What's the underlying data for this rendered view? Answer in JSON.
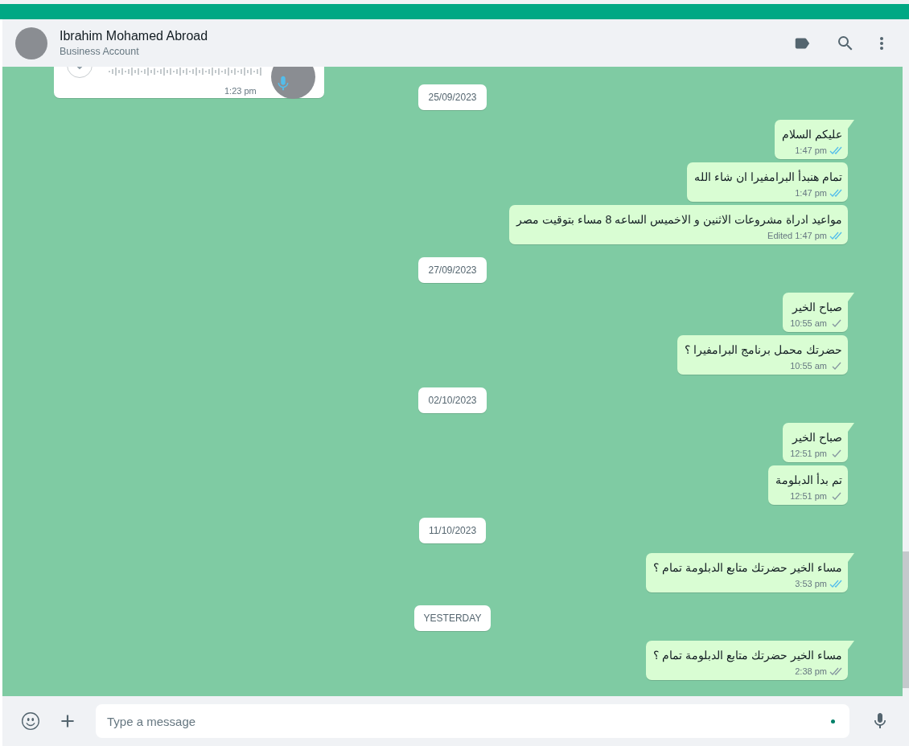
{
  "header": {
    "name": "Ibrahim Mohamed Abroad",
    "subtitle": "Business Account"
  },
  "voice_note": {
    "time": "1:23 pm"
  },
  "items": [
    {
      "kind": "date",
      "text": "25/09/2023"
    },
    {
      "kind": "message",
      "text": "عليكم السلام",
      "time": "1:47 pm",
      "delivered": true,
      "read": true,
      "tail": true
    },
    {
      "kind": "message",
      "text": "تمام هنبدأ البرامفيرا ان شاء الله",
      "time": "1:47 pm",
      "delivered": true,
      "read": true,
      "tail": false
    },
    {
      "kind": "message",
      "text": "مواعيد ادراة مشروعات الاثنين و الاخميس الساعه 8 مساء بتوقيت مصر",
      "time": "1:47 pm",
      "delivered": true,
      "read": true,
      "tail": false,
      "edited": "Edited"
    },
    {
      "kind": "date",
      "text": "27/09/2023"
    },
    {
      "kind": "message",
      "text": "صباح الخير",
      "time": "10:55 am",
      "delivered": false,
      "read": false,
      "tail": true
    },
    {
      "kind": "message",
      "text": "حضرتك محمل برنامج البرامفيرا ؟",
      "time": "10:55 am",
      "delivered": false,
      "read": false,
      "tail": false
    },
    {
      "kind": "date",
      "text": "02/10/2023"
    },
    {
      "kind": "message",
      "text": "صباح الخير",
      "time": "12:51 pm",
      "delivered": false,
      "read": false,
      "tail": true
    },
    {
      "kind": "message",
      "text": "تم بدأ الدبلومة",
      "time": "12:51 pm",
      "delivered": false,
      "read": false,
      "tail": false
    },
    {
      "kind": "date",
      "text": "11/10/2023"
    },
    {
      "kind": "message",
      "text": "مساء الخير حضرتك متابع الدبلومة تمام ؟",
      "time": "3:53 pm",
      "delivered": true,
      "read": true,
      "tail": true
    },
    {
      "kind": "date",
      "text": "YESTERDAY"
    },
    {
      "kind": "message",
      "text": "مساء الخير حضرتك متابع الدبلومة تمام ؟",
      "time": "2:38 pm",
      "delivered": true,
      "read": false,
      "tail": true
    }
  ],
  "composer": {
    "placeholder": "Type a message"
  }
}
